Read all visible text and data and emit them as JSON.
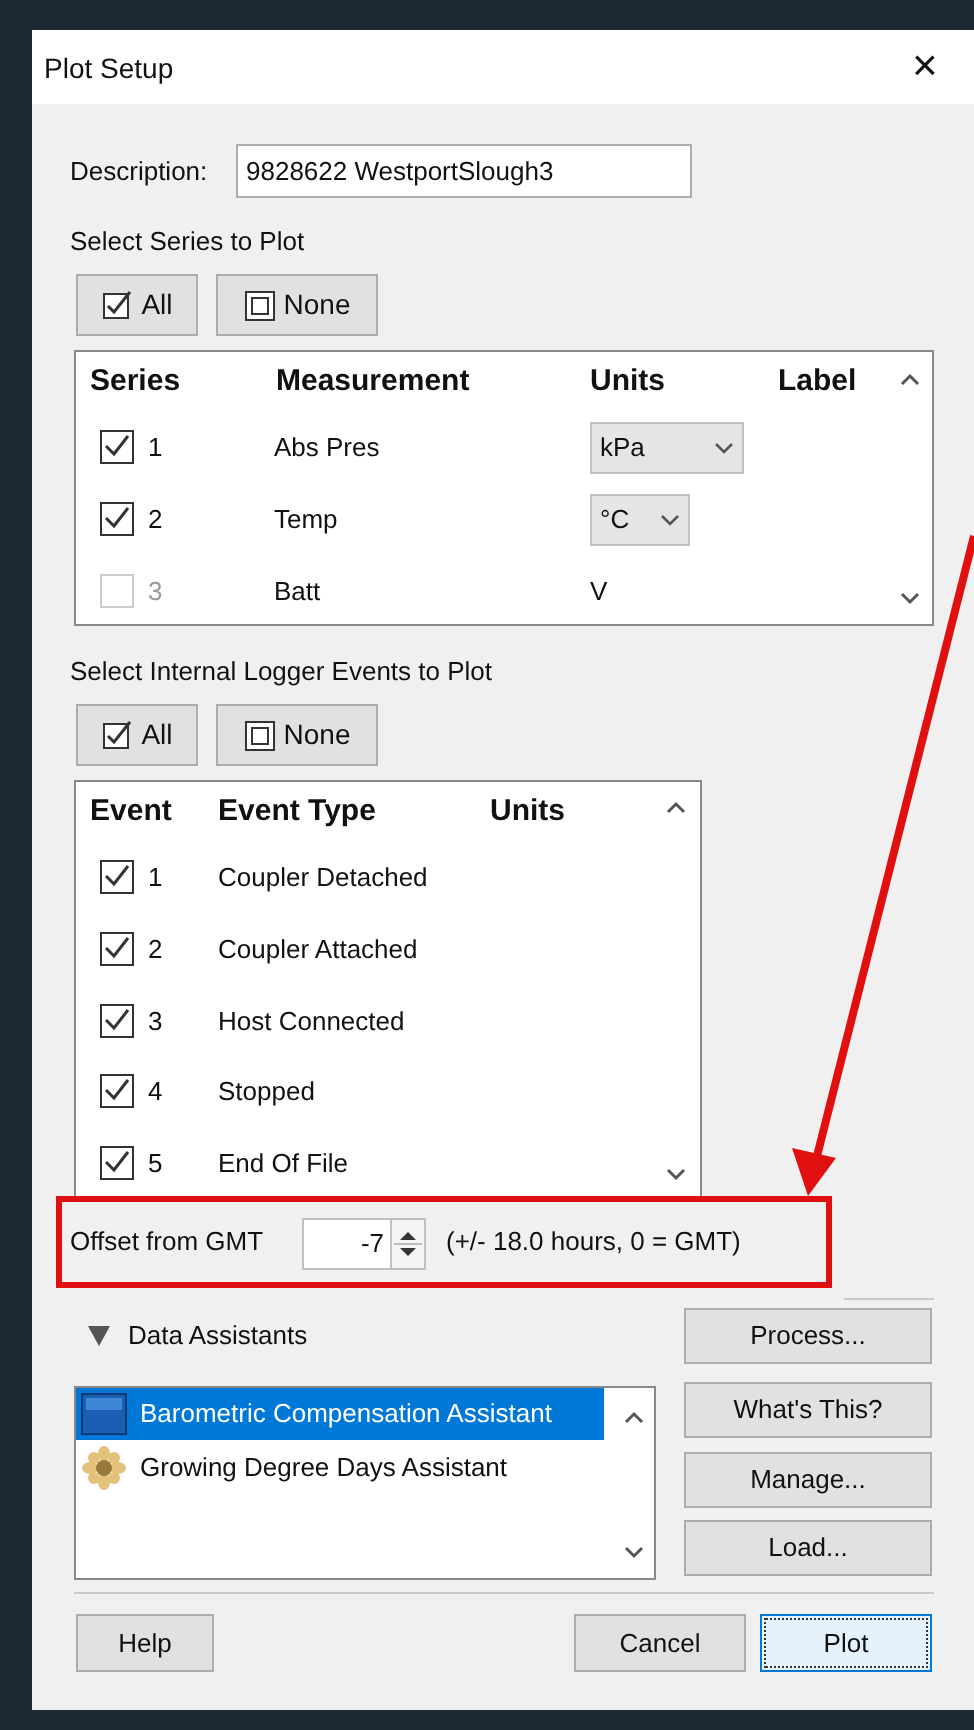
{
  "window": {
    "title": "Plot Setup",
    "close": "×"
  },
  "description": {
    "label": "Description:",
    "value": "9828622 WestportSlough3"
  },
  "series_section": {
    "title": "Select Series to Plot",
    "buttons": [
      "All",
      "None"
    ],
    "columns": [
      "Series",
      "Measurement",
      "Units",
      "Label"
    ],
    "rows": [
      {
        "number": "1",
        "measurement": "Abs Pres",
        "units": "kPa",
        "kind": "dropdown",
        "checked": true,
        "disabled": false
      },
      {
        "number": "2",
        "measurement": "Temp",
        "units": "°C",
        "kind": "dropdown",
        "checked": true,
        "disabled": false
      },
      {
        "number": "3",
        "measurement": "Batt",
        "units": "V",
        "kind": "text",
        "checked": false,
        "disabled": true
      }
    ]
  },
  "events_section": {
    "title": "Select Internal Logger Events to Plot",
    "buttons": [
      "All",
      "None"
    ],
    "columns": [
      "Event",
      "Event Type",
      "Units"
    ],
    "rows": [
      {
        "number": "1",
        "type": "Coupler Detached",
        "checked": true
      },
      {
        "number": "2",
        "type": "Coupler Attached",
        "checked": true
      },
      {
        "number": "3",
        "type": "Host Connected",
        "checked": true
      },
      {
        "number": "4",
        "type": "Stopped",
        "checked": true
      },
      {
        "number": "5",
        "type": "End Of File",
        "checked": true
      }
    ]
  },
  "gmt_offset": {
    "label": "Offset from GMT",
    "value": "-7",
    "hint": "(+/- 18.0 hours, 0 = GMT)"
  },
  "data_assistants": {
    "title": "Data Assistants",
    "expanded": true,
    "items": [
      {
        "label": "Barometric Compensation Assistant",
        "selected": true
      },
      {
        "label": "Growing Degree Days Assistant",
        "selected": false
      }
    ],
    "buttons": [
      "Process...",
      "What's This?",
      "Manage...",
      "Load..."
    ]
  },
  "footer_buttons": [
    {
      "label": "Help",
      "focused": false
    },
    {
      "label": "Cancel",
      "focused": false
    },
    {
      "label": "Plot",
      "focused": true
    }
  ]
}
